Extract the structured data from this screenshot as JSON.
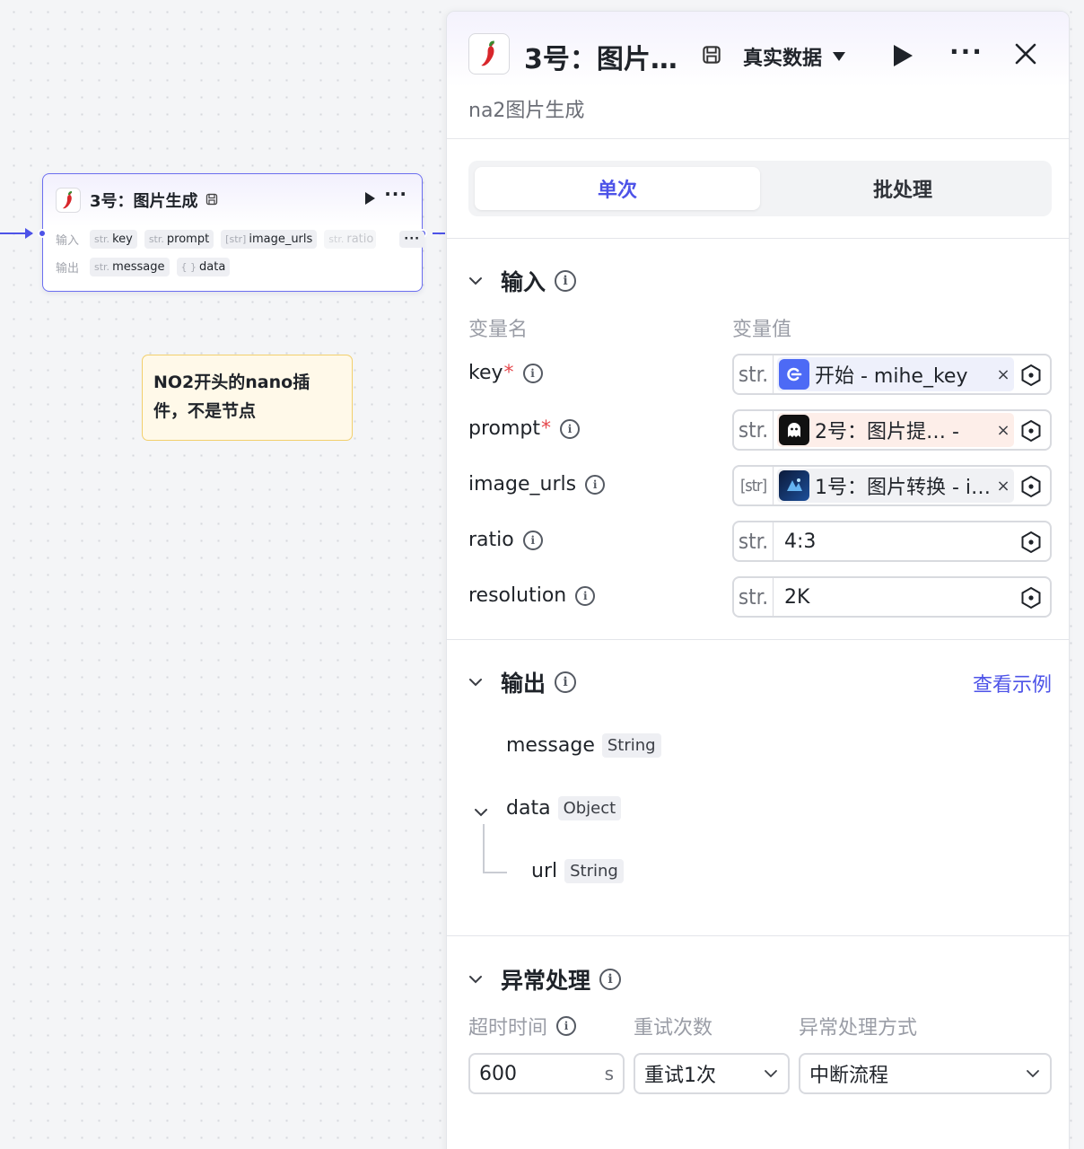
{
  "canvas": {
    "node": {
      "title": "3号：图片生成",
      "input_label": "输入",
      "output_label": "输出",
      "inputs": [
        {
          "type": "str.",
          "name": "key"
        },
        {
          "type": "str.",
          "name": "prompt"
        },
        {
          "type": "[str]",
          "name": "image_urls"
        },
        {
          "type": "str.",
          "name": "ratio"
        }
      ],
      "more_label": "···",
      "outputs": [
        {
          "type": "str.",
          "name": "message"
        },
        {
          "type": "{ }",
          "name": "data"
        }
      ]
    },
    "note": {
      "line1": "NO2开头的nano插",
      "line2": "件，不是节点"
    }
  },
  "panel": {
    "title": "3号：图片…",
    "mode_label": "真实数据",
    "subtitle": "na2图片生成",
    "more_label": "···",
    "tabs": [
      {
        "label": "单次",
        "active": true
      },
      {
        "label": "批处理",
        "active": false
      }
    ],
    "input_section": {
      "title": "输入",
      "col_name": "变量名",
      "col_value": "变量值",
      "rows": [
        {
          "name": "key",
          "required": true,
          "type": "str.",
          "ref": "开始 - mihe_key",
          "ref_style": "blue"
        },
        {
          "name": "prompt",
          "required": true,
          "type": "str.",
          "ref": "2号：图片提…  -",
          "ref_style": "peach"
        },
        {
          "name": "image_urls",
          "required": false,
          "type": "[str]",
          "ref": "1号：图片转换 - i…",
          "ref_style": "grey"
        },
        {
          "name": "ratio",
          "required": false,
          "type": "str.",
          "value": "4:3"
        },
        {
          "name": "resolution",
          "required": false,
          "type": "str.",
          "value": "2K"
        }
      ],
      "required_mark": "*",
      "remove_mark": "×"
    },
    "output_section": {
      "title": "输出",
      "example_link": "查看示例",
      "fields": [
        {
          "name": "message",
          "type": "String"
        },
        {
          "name": "data",
          "type": "Object"
        },
        {
          "name": "url",
          "type": "String"
        }
      ]
    },
    "error_section": {
      "title": "异常处理",
      "timeout_label": "超时时间",
      "retry_label": "重试次数",
      "method_label": "异常处理方式",
      "timeout_value": "600",
      "timeout_unit": "s",
      "retry_value": "重试1次",
      "method_value": "中断流程"
    }
  },
  "colors": {
    "accent": "#4d53e8",
    "required": "#e5484d",
    "note_bg": "#fff9e9",
    "note_border": "#f2cf6c"
  },
  "icons": [
    "chili-pepper-icon",
    "save-icon",
    "play-icon",
    "more-icon",
    "close-icon",
    "chevron-down-icon",
    "info-icon",
    "variable-hex-icon",
    "start-node-icon",
    "ghost-node-icon",
    "image-convert-node-icon"
  ]
}
